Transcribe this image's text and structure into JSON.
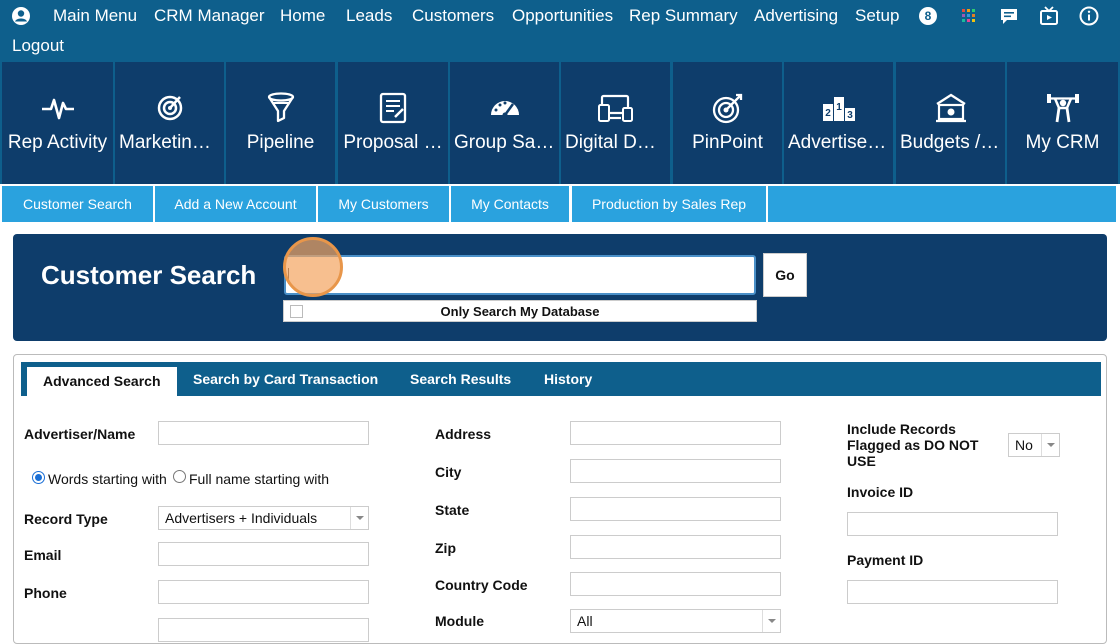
{
  "topnav": {
    "items": [
      "Main Menu",
      "CRM Manager",
      "Home",
      "Leads",
      "Customers",
      "Opportunities",
      "Rep Summary",
      "Advertising",
      "Setup"
    ],
    "badge_count": "8",
    "logout": "Logout",
    "icons": [
      "user-icon",
      "apps-grid-icon",
      "chat-icon",
      "tv-icon",
      "info-icon"
    ]
  },
  "tiles": [
    "Rep Activity",
    "Marketing…",
    "Pipeline",
    "Proposal …",
    "Group Sal…",
    "Digital De…",
    "PinPoint",
    "Advertiser…",
    "Budgets / …",
    "My CRM"
  ],
  "tile_icons": [
    "pulse-icon",
    "target-icon",
    "funnel-icon",
    "document-edit-icon",
    "gauge-icon",
    "devices-icon",
    "bullseye-icon",
    "podium-icon",
    "money-house-icon",
    "weightlifter-icon"
  ],
  "subtabs": [
    "Customer Search",
    "Add a New Account",
    "My Customers",
    "My Contacts",
    "Production by Sales Rep"
  ],
  "search": {
    "title": "Customer Search",
    "value": "",
    "go": "Go",
    "only_my_db": "Only Search My Database"
  },
  "advanced": {
    "tabs": [
      "Advanced Search",
      "Search by Card Transaction",
      "Search Results",
      "History"
    ],
    "left": {
      "advertiser_label": "Advertiser/Name",
      "radio_words": "Words starting with",
      "radio_full": "Full name starting with",
      "record_type_label": "Record Type",
      "record_type_value": "Advertisers + Individuals",
      "email_label": "Email",
      "phone_label": "Phone"
    },
    "middle": {
      "address_label": "Address",
      "city_label": "City",
      "state_label": "State",
      "zip_label": "Zip",
      "country_label": "Country Code",
      "module_label": "Module",
      "module_value": "All"
    },
    "right": {
      "flag_label_1": "Include Records",
      "flag_label_2": "Flagged as DO NOT",
      "flag_label_3": "USE",
      "flag_value": "No",
      "invoice_label": "Invoice ID",
      "payment_label": "Payment ID"
    }
  },
  "colors": {
    "nav_blue": "#0e5f8c",
    "tile_navy": "#0e3d6b",
    "subtab_blue": "#2aa2de",
    "highlight_orange": "#e8964a"
  }
}
